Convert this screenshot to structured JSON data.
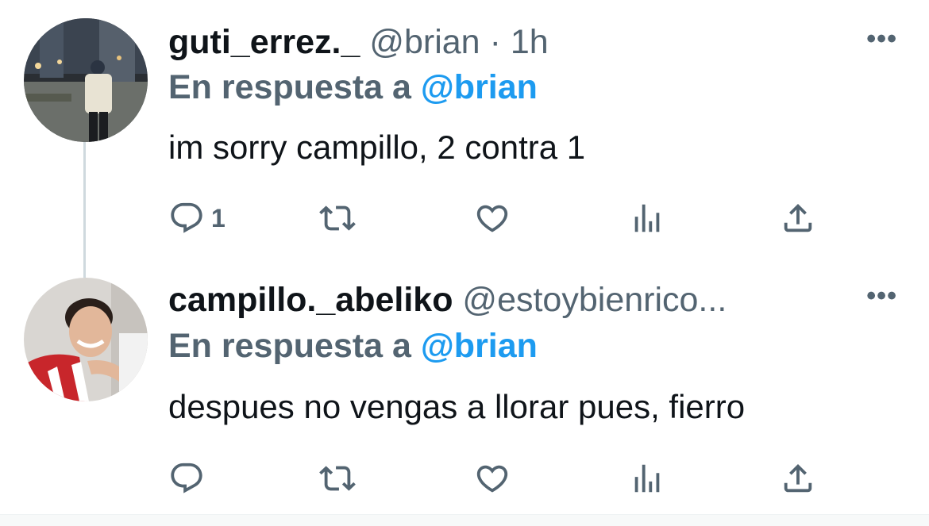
{
  "tweets": [
    {
      "display_name": "guti_errez._",
      "handle": "@brian",
      "separator": "·",
      "time": "1h",
      "reply_prefix": "En respuesta a",
      "reply_mention": "@brian",
      "text": "im sorry campillo, 2 contra 1",
      "reply_count": "1",
      "more_label": "•••",
      "icons": [
        "reply-icon",
        "retweet-icon",
        "like-icon",
        "views-icon",
        "share-icon"
      ]
    },
    {
      "display_name": "campillo._abeliko",
      "handle": "@estoybienrico...",
      "reply_prefix": "En respuesta a",
      "reply_mention": "@brian",
      "text": "despues no vengas a llorar pues, fierro",
      "reply_count": "",
      "more_label": "•••",
      "icons": [
        "reply-icon",
        "retweet-icon",
        "like-icon",
        "views-icon",
        "share-icon"
      ]
    }
  ],
  "colors": {
    "text_primary": "#0f1419",
    "text_secondary": "#536471",
    "mention": "#1d9bf0",
    "icon": "#536471",
    "thread_line": "#cfd9de"
  }
}
